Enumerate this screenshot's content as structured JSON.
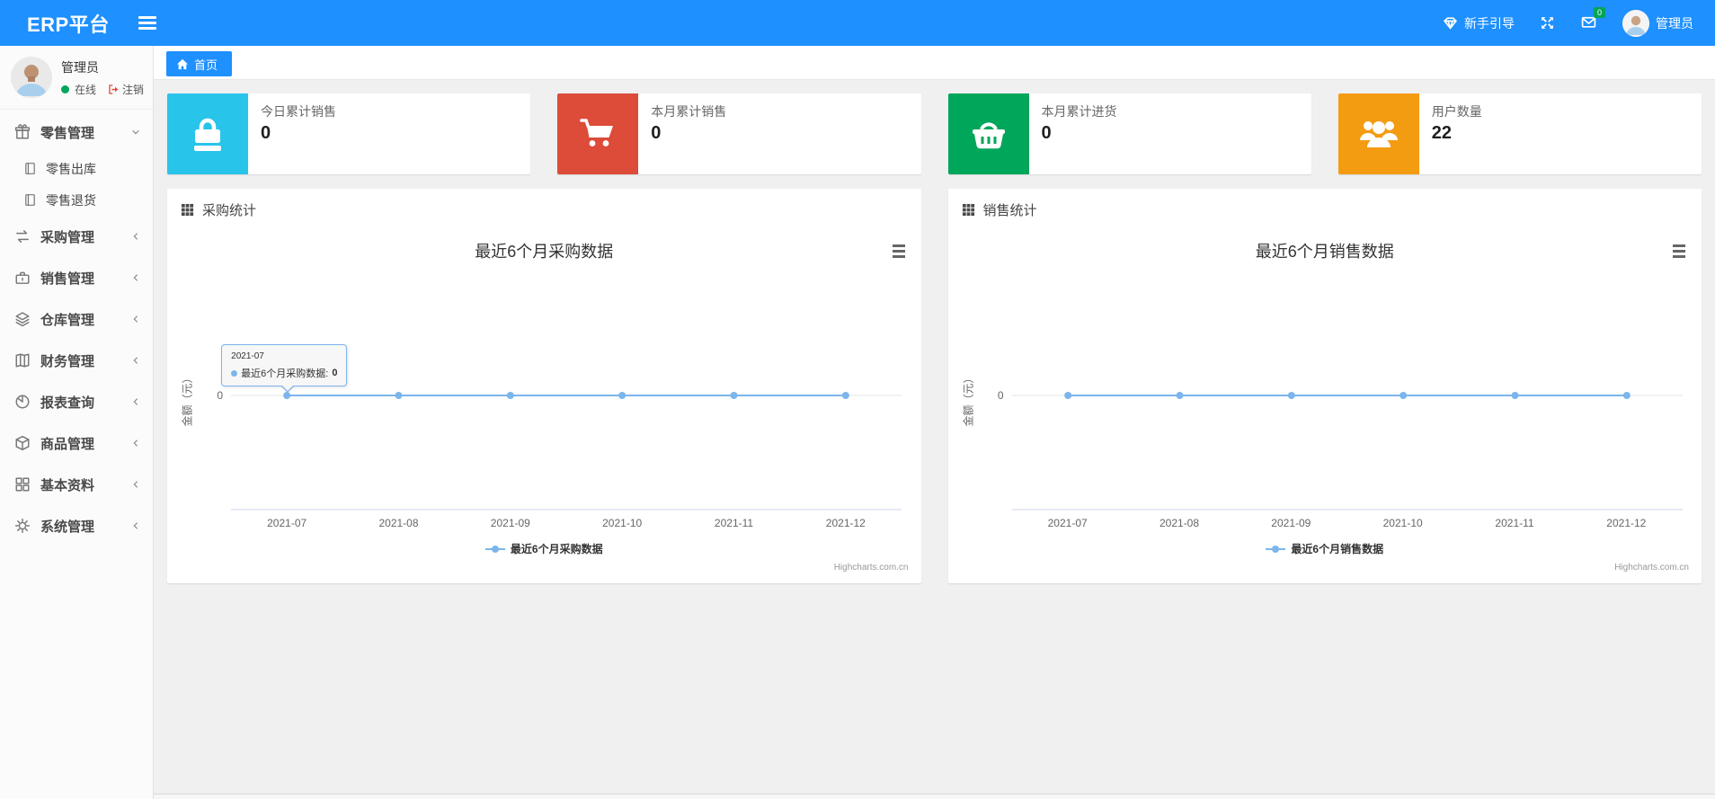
{
  "colors": {
    "header_blue": "#1e90ff",
    "chart_line": "#7cb5ec",
    "online_green": "#00a65a"
  },
  "header": {
    "brand": "ERP平台",
    "guide_label": "新手引导",
    "mail_badge": "0",
    "username": "管理员"
  },
  "sidebar": {
    "user": {
      "name": "管理员",
      "status_label": "在线",
      "logout_label": "注销"
    },
    "menu": [
      {
        "label": "零售管理",
        "icon": "gift-icon",
        "state": "expanded",
        "children": [
          {
            "label": "零售出库",
            "icon": "file-icon"
          },
          {
            "label": "零售退货",
            "icon": "file-icon"
          }
        ]
      },
      {
        "label": "采购管理",
        "icon": "exchange-icon",
        "state": "collapsed"
      },
      {
        "label": "销售管理",
        "icon": "briefcase-icon",
        "state": "collapsed"
      },
      {
        "label": "仓库管理",
        "icon": "layers-icon",
        "state": "collapsed"
      },
      {
        "label": "财务管理",
        "icon": "ledger-icon",
        "state": "collapsed"
      },
      {
        "label": "报表查询",
        "icon": "report-icon",
        "state": "collapsed"
      },
      {
        "label": "商品管理",
        "icon": "product-box-icon",
        "state": "collapsed"
      },
      {
        "label": "基本资料",
        "icon": "grid-icon",
        "state": "collapsed"
      },
      {
        "label": "系统管理",
        "icon": "gear-icon",
        "state": "collapsed"
      }
    ]
  },
  "breadcrumb": {
    "home_label": "首页"
  },
  "stats": [
    {
      "label": "今日累计销售",
      "value": "0",
      "color": "#29c4e9",
      "icon": "shopping-bag-icon"
    },
    {
      "label": "本月累计销售",
      "value": "0",
      "color": "#dd4b39",
      "icon": "shopping-cart-icon"
    },
    {
      "label": "本月累计进货",
      "value": "0",
      "color": "#00a65a",
      "icon": "basket-icon"
    },
    {
      "label": "用户数量",
      "value": "22",
      "color": "#f39c12",
      "icon": "users-icon"
    }
  ],
  "chart_data": [
    {
      "type": "line",
      "panel_title": "采购统计",
      "title": "最近6个月采购数据",
      "categories": [
        "2021-07",
        "2021-08",
        "2021-09",
        "2021-10",
        "2021-11",
        "2021-12"
      ],
      "values": [
        0,
        0,
        0,
        0,
        0,
        0
      ],
      "xlabel": "",
      "ylabel": "金额（元）",
      "ytick": "0",
      "ylim": [
        0,
        0
      ],
      "grid": "zero-line-only",
      "legend": "最近6个月采购数据",
      "legend_position": "bottom",
      "line_color": "#7cb5ec",
      "credits": "Highcharts.com.cn",
      "tooltip": {
        "header": "2021-07",
        "series": "最近6个月采购数据: ",
        "value": "0"
      }
    },
    {
      "type": "line",
      "panel_title": "销售统计",
      "title": "最近6个月销售数据",
      "categories": [
        "2021-07",
        "2021-08",
        "2021-09",
        "2021-10",
        "2021-11",
        "2021-12"
      ],
      "values": [
        0,
        0,
        0,
        0,
        0,
        0
      ],
      "xlabel": "",
      "ylabel": "金额（元）",
      "ytick": "0",
      "ylim": [
        0,
        0
      ],
      "grid": "zero-line-only",
      "legend": "最近6个月销售数据",
      "legend_position": "bottom",
      "line_color": "#7cb5ec",
      "credits": "Highcharts.com.cn"
    }
  ]
}
